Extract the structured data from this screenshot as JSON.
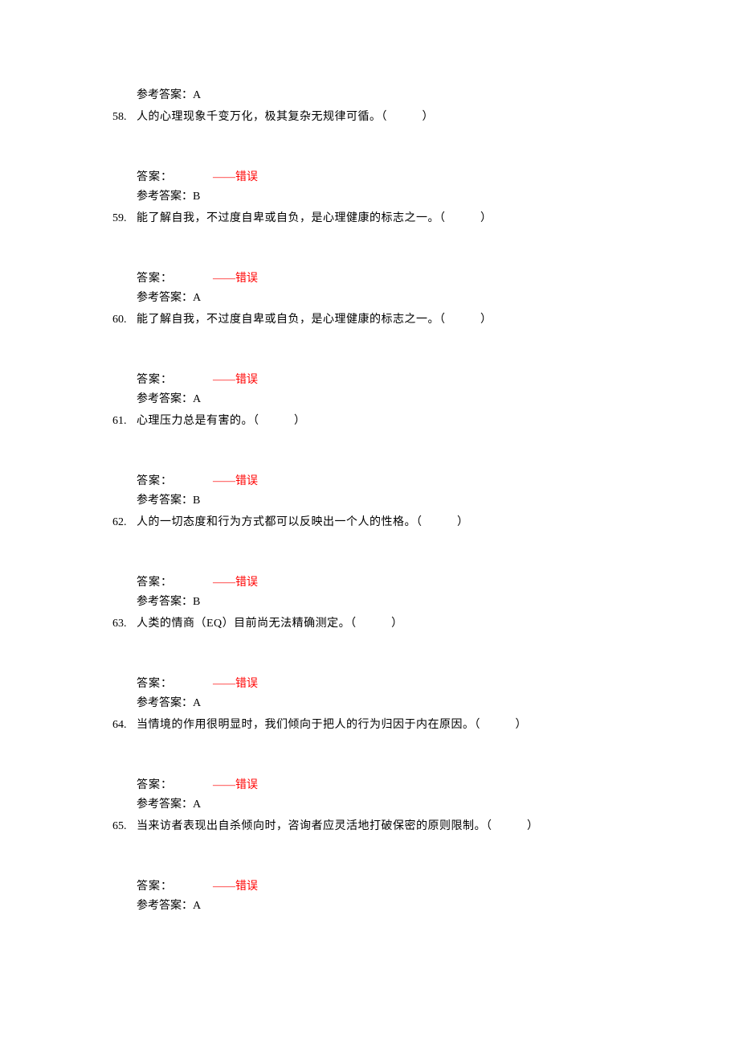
{
  "strings": {
    "ref_label": "参考答案：",
    "ans_label": "答案：",
    "dash": "——",
    "wrong": "错误"
  },
  "top_ref": "A",
  "questions": [
    {
      "num": "58.",
      "text": "人的心理现象千变万化，极其复杂无规律可循。（　　　）",
      "ref": "B"
    },
    {
      "num": "59.",
      "text": "能了解自我，不过度自卑或自负，是心理健康的标志之一。（　　　）",
      "ref": "A"
    },
    {
      "num": "60.",
      "text": "能了解自我，不过度自卑或自负，是心理健康的标志之一。（　　　）",
      "ref": "A"
    },
    {
      "num": "61.",
      "text": "心理压力总是有害的。（　　　）",
      "ref": "B"
    },
    {
      "num": "62.",
      "text": "人的一切态度和行为方式都可以反映出一个人的性格。（　　　）",
      "ref": "B"
    },
    {
      "num": "63.",
      "text": "人类的情商（EQ）目前尚无法精确测定。（　　　）",
      "ref": "A"
    },
    {
      "num": "64.",
      "text": "当情境的作用很明显时，我们倾向于把人的行为归因于内在原因。（　　　）",
      "ref": "A"
    },
    {
      "num": "65.",
      "text": "当来访者表现出自杀倾向时，咨询者应灵活地打破保密的原则限制。（　　　）",
      "ref": "A"
    }
  ]
}
